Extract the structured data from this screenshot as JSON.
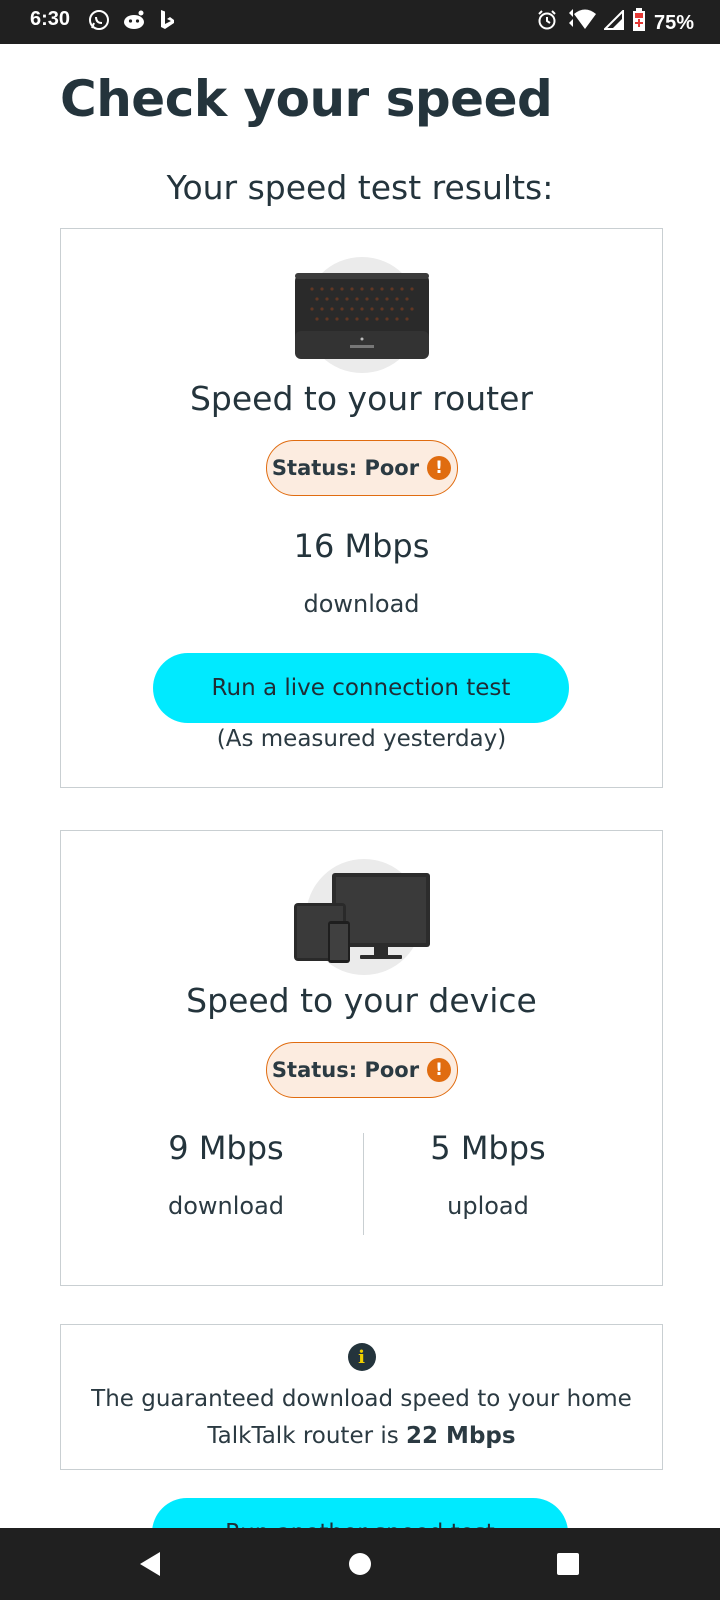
{
  "status_bar": {
    "time": "6:30",
    "battery": "75%",
    "left_icons": [
      "whatsapp-icon",
      "reddit-icon",
      "bing-icon"
    ],
    "right_icons": [
      "alarm-icon",
      "wifi-icon",
      "signal-icon",
      "battery-icon"
    ]
  },
  "page": {
    "title": "Check your speed",
    "subheading": "Your speed test results:"
  },
  "router_card": {
    "image": "router-image",
    "title": "Speed to your router",
    "status": "Status: Poor",
    "download_value": "16 Mbps",
    "download_label": "download",
    "button_label": "Run a live connection test",
    "note": "(As measured yesterday)"
  },
  "device_card": {
    "image": "devices-image",
    "title": "Speed to your device",
    "status": "Status: Poor",
    "download_value": "9 Mbps",
    "download_label": "download",
    "upload_value": "5 Mbps",
    "upload_label": "upload"
  },
  "info_card": {
    "text_prefix": "The guaranteed download speed to your home TalkTalk router is ",
    "text_value": "22 Mbps"
  },
  "bottom_button": {
    "label": "Run another speed test"
  },
  "colors": {
    "accent": "#00eaff",
    "warning": "#e06c10",
    "warning_bg": "#fcece0",
    "text": "#24343c",
    "bars": "#202020"
  }
}
